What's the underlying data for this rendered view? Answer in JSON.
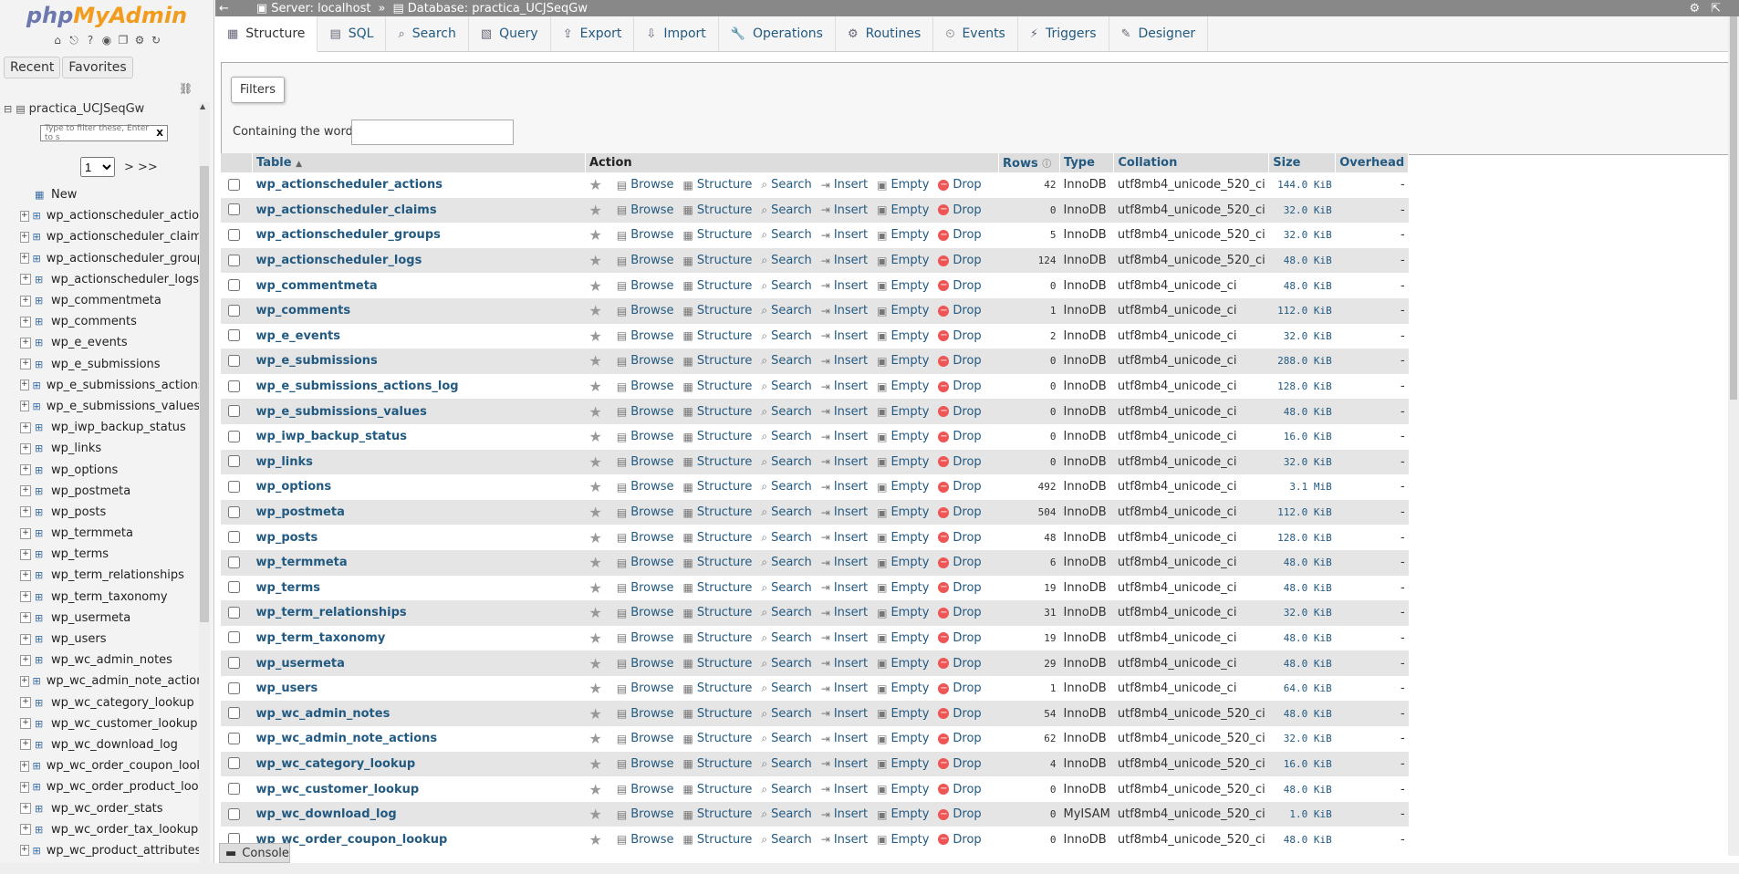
{
  "app": {
    "logo_a": "php",
    "logo_b": "MyAdmin"
  },
  "sidebar": {
    "recent": "Recent",
    "favorites": "Favorites",
    "db_name": "practica_UCJSeqGw",
    "filter_placeholder": "Type to filter these, Enter to s",
    "filter_clear": "X",
    "page_value": "1",
    "page_next": "> >>",
    "new_label": "New",
    "tables": [
      "wp_actionscheduler_actions",
      "wp_actionscheduler_claims",
      "wp_actionscheduler_groups",
      "wp_actionscheduler_logs",
      "wp_commentmeta",
      "wp_comments",
      "wp_e_events",
      "wp_e_submissions",
      "wp_e_submissions_actions_log",
      "wp_e_submissions_values",
      "wp_iwp_backup_status",
      "wp_links",
      "wp_options",
      "wp_postmeta",
      "wp_posts",
      "wp_termmeta",
      "wp_terms",
      "wp_term_relationships",
      "wp_term_taxonomy",
      "wp_usermeta",
      "wp_users",
      "wp_wc_admin_notes",
      "wp_wc_admin_note_actions",
      "wp_wc_category_lookup",
      "wp_wc_customer_lookup",
      "wp_wc_download_log",
      "wp_wc_order_coupon_lookup",
      "wp_wc_order_product_lookup",
      "wp_wc_order_stats",
      "wp_wc_order_tax_lookup",
      "wp_wc_product_attributes_lookup"
    ]
  },
  "breadcrumb": {
    "server": "Server: localhost",
    "sep": "»",
    "database": "Database: practica_UCJSeqGw"
  },
  "tabs": [
    "Structure",
    "SQL",
    "Search",
    "Query",
    "Export",
    "Import",
    "Operations",
    "Routines",
    "Events",
    "Triggers",
    "Designer"
  ],
  "filters": {
    "legend": "Filters",
    "label": "Containing the word:"
  },
  "table_headers": {
    "table": "Table",
    "action": "Action",
    "rows": "Rows",
    "type": "Type",
    "collation": "Collation",
    "size": "Size",
    "overhead": "Overhead"
  },
  "actions": {
    "browse": "Browse",
    "structure": "Structure",
    "search": "Search",
    "insert": "Insert",
    "empty": "Empty",
    "drop": "Drop"
  },
  "rows": [
    {
      "name": "wp_actionscheduler_actions",
      "rows": "42",
      "type": "InnoDB",
      "collation": "utf8mb4_unicode_520_ci",
      "size": "144.0 KiB",
      "overhead": "-"
    },
    {
      "name": "wp_actionscheduler_claims",
      "rows": "0",
      "type": "InnoDB",
      "collation": "utf8mb4_unicode_520_ci",
      "size": "32.0 KiB",
      "overhead": "-"
    },
    {
      "name": "wp_actionscheduler_groups",
      "rows": "5",
      "type": "InnoDB",
      "collation": "utf8mb4_unicode_520_ci",
      "size": "32.0 KiB",
      "overhead": "-"
    },
    {
      "name": "wp_actionscheduler_logs",
      "rows": "124",
      "type": "InnoDB",
      "collation": "utf8mb4_unicode_520_ci",
      "size": "48.0 KiB",
      "overhead": "-"
    },
    {
      "name": "wp_commentmeta",
      "rows": "0",
      "type": "InnoDB",
      "collation": "utf8mb4_unicode_ci",
      "size": "48.0 KiB",
      "overhead": "-"
    },
    {
      "name": "wp_comments",
      "rows": "1",
      "type": "InnoDB",
      "collation": "utf8mb4_unicode_ci",
      "size": "112.0 KiB",
      "overhead": "-"
    },
    {
      "name": "wp_e_events",
      "rows": "2",
      "type": "InnoDB",
      "collation": "utf8mb4_unicode_ci",
      "size": "32.0 KiB",
      "overhead": "-"
    },
    {
      "name": "wp_e_submissions",
      "rows": "0",
      "type": "InnoDB",
      "collation": "utf8mb4_unicode_ci",
      "size": "288.0 KiB",
      "overhead": "-"
    },
    {
      "name": "wp_e_submissions_actions_log",
      "rows": "0",
      "type": "InnoDB",
      "collation": "utf8mb4_unicode_ci",
      "size": "128.0 KiB",
      "overhead": "-"
    },
    {
      "name": "wp_e_submissions_values",
      "rows": "0",
      "type": "InnoDB",
      "collation": "utf8mb4_unicode_ci",
      "size": "48.0 KiB",
      "overhead": "-"
    },
    {
      "name": "wp_iwp_backup_status",
      "rows": "0",
      "type": "InnoDB",
      "collation": "utf8mb4_unicode_ci",
      "size": "16.0 KiB",
      "overhead": "-"
    },
    {
      "name": "wp_links",
      "rows": "0",
      "type": "InnoDB",
      "collation": "utf8mb4_unicode_ci",
      "size": "32.0 KiB",
      "overhead": "-"
    },
    {
      "name": "wp_options",
      "rows": "492",
      "type": "InnoDB",
      "collation": "utf8mb4_unicode_ci",
      "size": "3.1 MiB",
      "overhead": "-"
    },
    {
      "name": "wp_postmeta",
      "rows": "504",
      "type": "InnoDB",
      "collation": "utf8mb4_unicode_ci",
      "size": "112.0 KiB",
      "overhead": "-"
    },
    {
      "name": "wp_posts",
      "rows": "48",
      "type": "InnoDB",
      "collation": "utf8mb4_unicode_ci",
      "size": "128.0 KiB",
      "overhead": "-"
    },
    {
      "name": "wp_termmeta",
      "rows": "6",
      "type": "InnoDB",
      "collation": "utf8mb4_unicode_ci",
      "size": "48.0 KiB",
      "overhead": "-"
    },
    {
      "name": "wp_terms",
      "rows": "19",
      "type": "InnoDB",
      "collation": "utf8mb4_unicode_ci",
      "size": "48.0 KiB",
      "overhead": "-"
    },
    {
      "name": "wp_term_relationships",
      "rows": "31",
      "type": "InnoDB",
      "collation": "utf8mb4_unicode_ci",
      "size": "32.0 KiB",
      "overhead": "-"
    },
    {
      "name": "wp_term_taxonomy",
      "rows": "19",
      "type": "InnoDB",
      "collation": "utf8mb4_unicode_ci",
      "size": "48.0 KiB",
      "overhead": "-"
    },
    {
      "name": "wp_usermeta",
      "rows": "29",
      "type": "InnoDB",
      "collation": "utf8mb4_unicode_ci",
      "size": "48.0 KiB",
      "overhead": "-"
    },
    {
      "name": "wp_users",
      "rows": "1",
      "type": "InnoDB",
      "collation": "utf8mb4_unicode_ci",
      "size": "64.0 KiB",
      "overhead": "-"
    },
    {
      "name": "wp_wc_admin_notes",
      "rows": "54",
      "type": "InnoDB",
      "collation": "utf8mb4_unicode_520_ci",
      "size": "48.0 KiB",
      "overhead": "-"
    },
    {
      "name": "wp_wc_admin_note_actions",
      "rows": "62",
      "type": "InnoDB",
      "collation": "utf8mb4_unicode_520_ci",
      "size": "32.0 KiB",
      "overhead": "-"
    },
    {
      "name": "wp_wc_category_lookup",
      "rows": "4",
      "type": "InnoDB",
      "collation": "utf8mb4_unicode_520_ci",
      "size": "16.0 KiB",
      "overhead": "-"
    },
    {
      "name": "wp_wc_customer_lookup",
      "rows": "0",
      "type": "InnoDB",
      "collation": "utf8mb4_unicode_520_ci",
      "size": "48.0 KiB",
      "overhead": "-"
    },
    {
      "name": "wp_wc_download_log",
      "rows": "0",
      "type": "MyISAM",
      "collation": "utf8mb4_unicode_520_ci",
      "size": "1.0 KiB",
      "overhead": "-"
    },
    {
      "name": "wp_wc_order_coupon_lookup",
      "rows": "0",
      "type": "InnoDB",
      "collation": "utf8mb4_unicode_520_ci",
      "size": "48.0 KiB",
      "overhead": "-"
    }
  ],
  "console": "Console"
}
